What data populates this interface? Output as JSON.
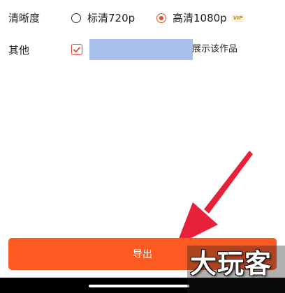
{
  "resolution": {
    "label": "清晰度",
    "options": [
      {
        "label": "标清720p",
        "checked": false
      },
      {
        "label": "高清1080p",
        "checked": true,
        "badge": "VIP"
      }
    ]
  },
  "other": {
    "label": "其他",
    "checked": true,
    "text": "展示该作品"
  },
  "export_button": {
    "label": "导出"
  },
  "watermark": {
    "text": "大玩客"
  },
  "colors": {
    "accent": "#fd5a22",
    "radio_checked": "#e14b2e",
    "arrow": "#e8203a",
    "redact": "#a9c0ec"
  }
}
